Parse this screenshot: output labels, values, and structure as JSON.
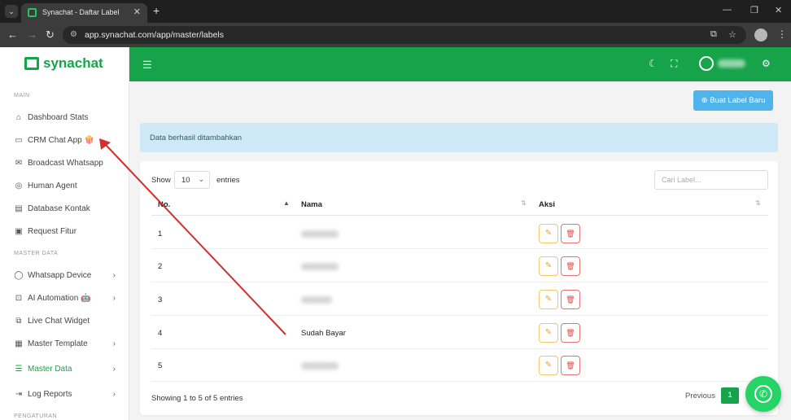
{
  "browser": {
    "tab_title": "Synachat - Daftar Label",
    "url": "app.synachat.com/app/master/labels",
    "tab_close": "✕",
    "new_tab": "+"
  },
  "sidebar": {
    "logo": "synachat",
    "sections": {
      "main": "MAIN",
      "master": "MASTER DATA",
      "settings": "PENGATURAN"
    },
    "items": [
      {
        "label": "Dashboard Stats",
        "icon": "home-icon"
      },
      {
        "label": "CRM Chat App 🍿",
        "icon": "chat-icon"
      },
      {
        "label": "Broadcast Whatsapp",
        "icon": "mail-icon"
      },
      {
        "label": "Human Agent",
        "icon": "user-circle-icon"
      },
      {
        "label": "Database Kontak",
        "icon": "contacts-icon"
      },
      {
        "label": "Request Fitur",
        "icon": "clipboard-icon"
      },
      {
        "label": "Whatsapp Device",
        "icon": "whatsapp-icon"
      },
      {
        "label": "AI Automation 🤖",
        "icon": "robot-icon"
      },
      {
        "label": "Live Chat Widget",
        "icon": "copy-icon"
      },
      {
        "label": "Master Template",
        "icon": "template-icon"
      },
      {
        "label": "Master Data",
        "icon": "list-icon"
      },
      {
        "label": "Log Reports",
        "icon": "log-icon"
      }
    ]
  },
  "main": {
    "new_label_button": "⊕ Buat Label Baru",
    "alert": "Data berhasil ditambahkan",
    "show": "Show",
    "entries_value": "10",
    "entries": "entries",
    "search_placeholder": "Cari Label...",
    "columns": [
      "No.",
      "Nama",
      "Aksi"
    ],
    "rows": [
      {
        "no": "1",
        "name": ""
      },
      {
        "no": "2",
        "name": ""
      },
      {
        "no": "3",
        "name": ""
      },
      {
        "no": "4",
        "name": "Sudah Bayar"
      },
      {
        "no": "5",
        "name": ""
      }
    ],
    "info": "Showing 1 to 5 of 5 entries",
    "previous": "Previous",
    "page": "1"
  },
  "colors": {
    "brand": "#16a34a",
    "info_button": "#4fb3ec",
    "alert_bg": "#cfe9f7",
    "annotation_arrow": "#d32f2f"
  }
}
